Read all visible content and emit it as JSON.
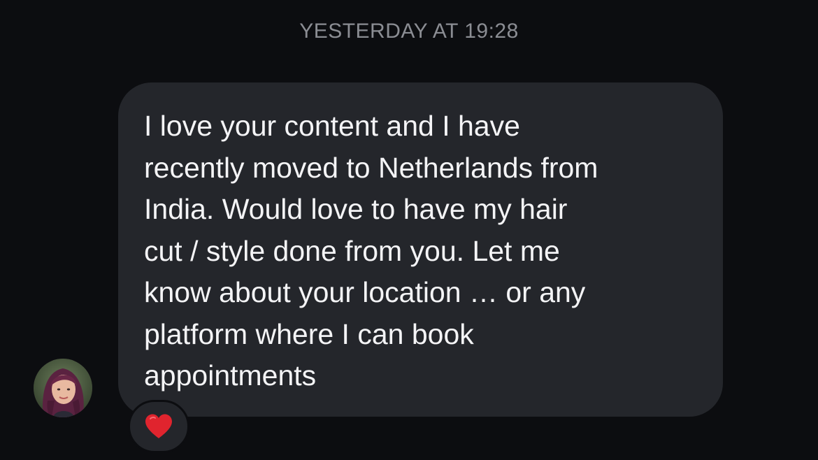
{
  "thread": {
    "timestamp": "YESTERDAY AT 19:28"
  },
  "message": {
    "text": "I love your content and I have\nrecently moved to Netherlands from\nIndia. Would love to have my hair\ncut / style done from you. Let me\nknow about your location … or any\nplatform where I can book\nappointments",
    "reaction": "heart-reaction-icon",
    "avatar": "sender-avatar"
  },
  "colors": {
    "background": "#0c0d10",
    "bubble": "#24262b",
    "timestamp": "#8b8d93",
    "text": "#f4f4f6",
    "heart": "#e0242e"
  }
}
